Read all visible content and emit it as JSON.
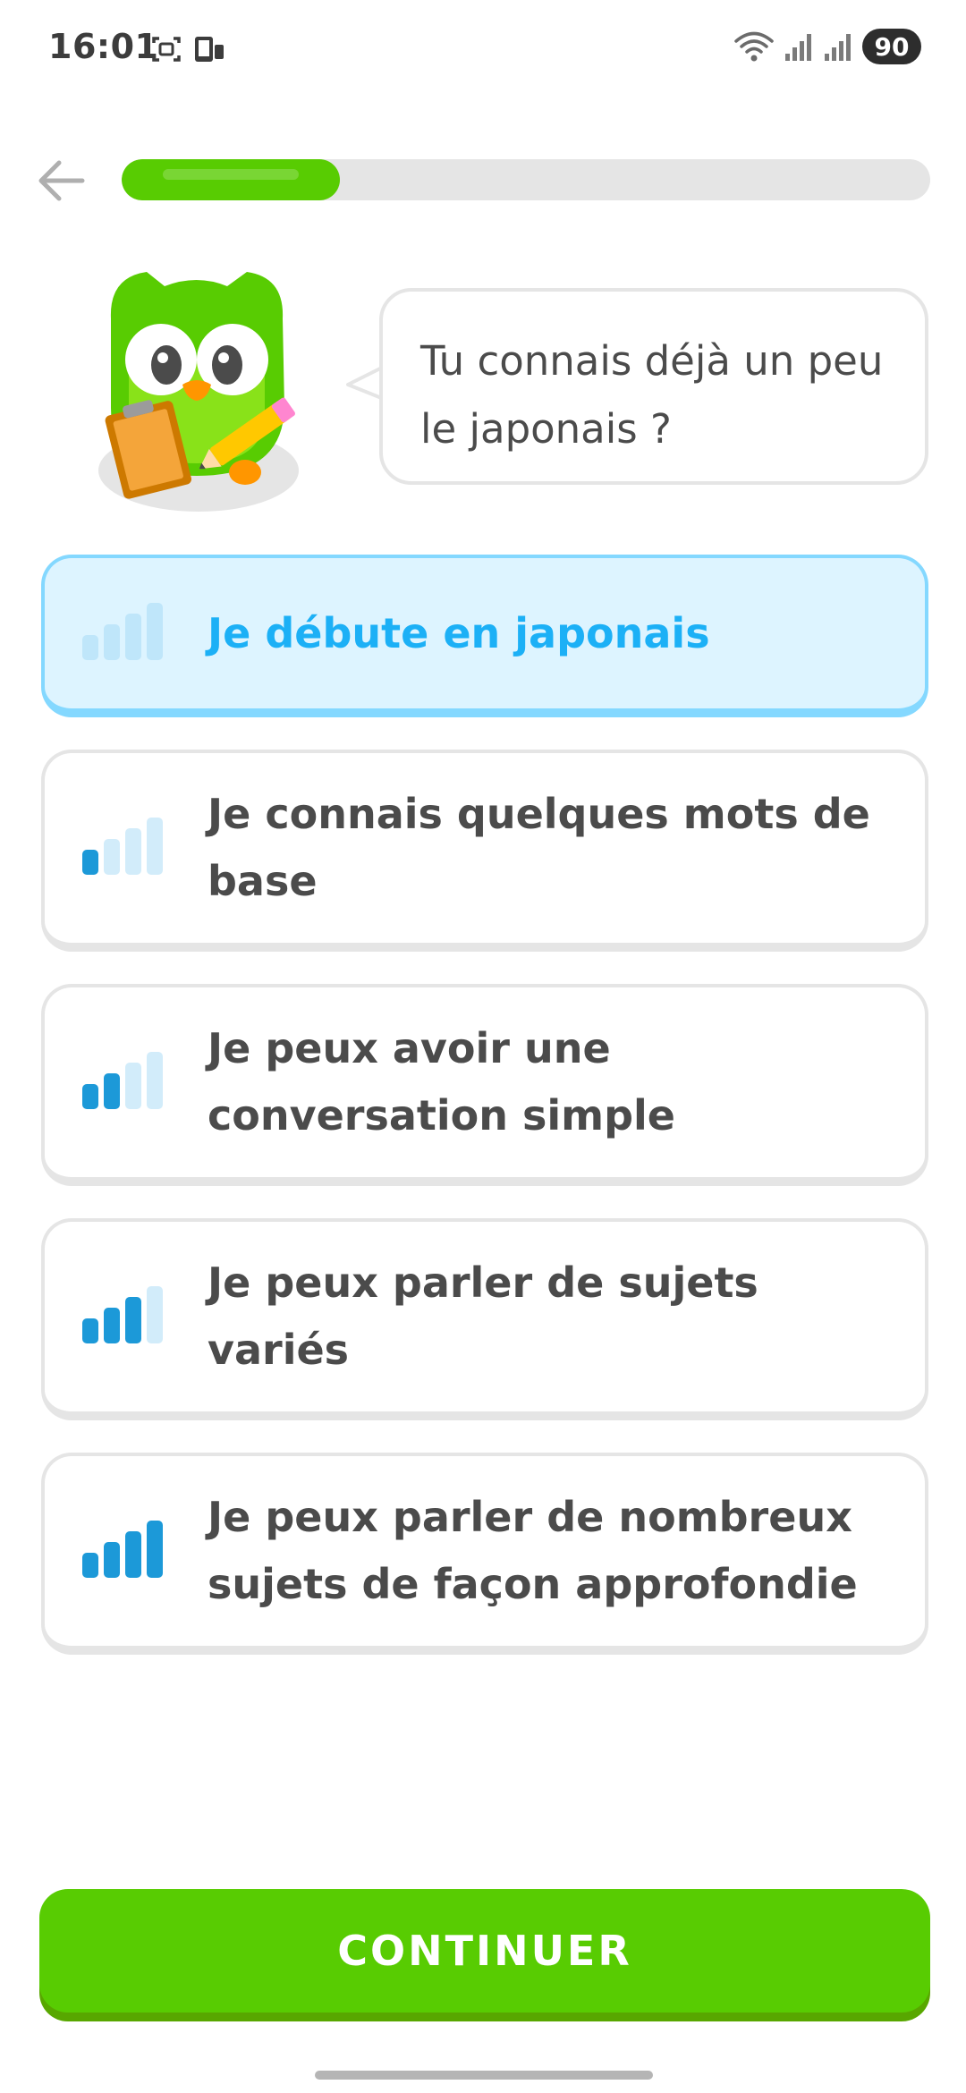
{
  "status_bar": {
    "time": "16:01",
    "battery": "90",
    "icons": [
      "screenshot-icon",
      "phone-icon",
      "wifi-icon",
      "signal-icon",
      "signal-icon"
    ]
  },
  "header": {
    "back_icon": "arrow-left-icon",
    "progress_fraction": 0.27
  },
  "prompt": {
    "text": "Tu connais déjà un peu le japonais ?"
  },
  "options": [
    {
      "label": "Je débute en japonais",
      "level": 0,
      "selected": true
    },
    {
      "label": "Je connais quelques mots de base",
      "level": 1,
      "selected": false
    },
    {
      "label": "Je peux avoir une conversation simple",
      "level": 2,
      "selected": false
    },
    {
      "label": "Je peux parler de sujets variés",
      "level": 3,
      "selected": false
    },
    {
      "label": "Je peux parler de nombreux sujets de façon approfondie",
      "level": 4,
      "selected": false
    }
  ],
  "continue_label": "CONTINUER",
  "colors": {
    "brand_green": "#58cc02",
    "selected_blue": "#1cb0f6",
    "selected_bg": "#ddf4ff",
    "bar_active": "#1c99d8",
    "bar_inactive": "#d2ecfa"
  }
}
